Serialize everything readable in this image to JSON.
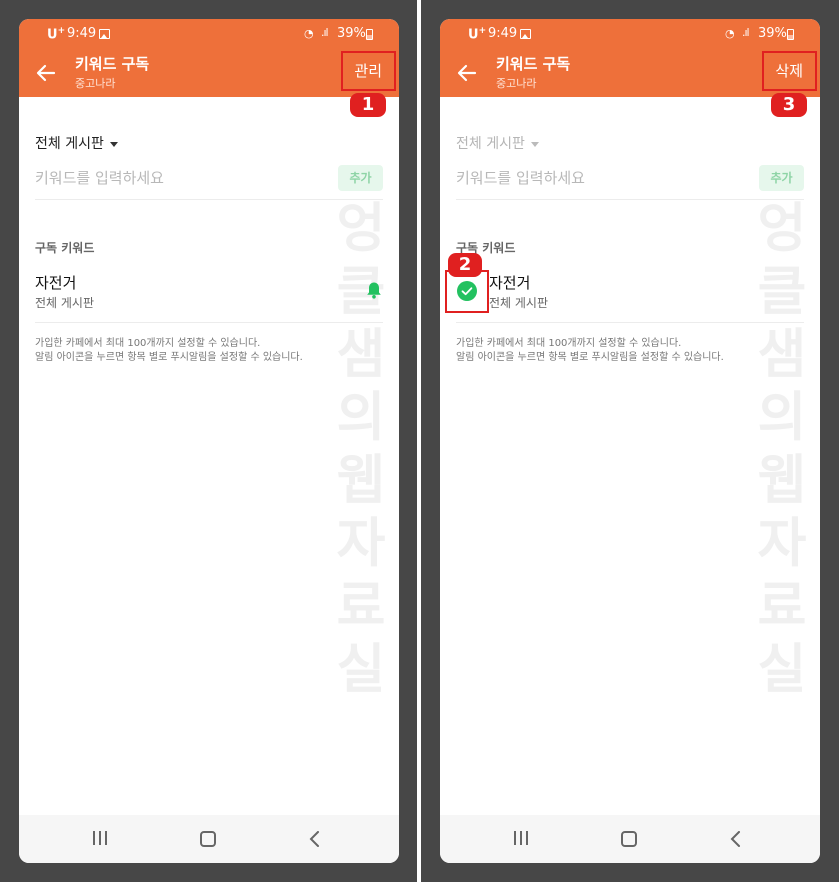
{
  "colors": {
    "accent": "#ee703a",
    "green": "#23c160",
    "highlight": "#e02020"
  },
  "status": {
    "carrier": "U",
    "carrier_mark": "+",
    "time": "9:49",
    "battery": "39%"
  },
  "header": {
    "title": "키워드 구독",
    "subtitle": "중고나라"
  },
  "screens": {
    "left": {
      "action_label": "관리",
      "badge": "1"
    },
    "right": {
      "action_label": "삭제",
      "badge_action": "3",
      "badge_check": "2"
    }
  },
  "filter_label": "전체 게시판",
  "keyword_input": {
    "placeholder": "키워드를 입력하세요"
  },
  "add_button": "추가",
  "section_title": "구독 키워드",
  "keyword_item": {
    "title": "자전거",
    "board": "전체 게시판"
  },
  "notes": [
    "가입한 카페에서 최대 100개까지 설정할 수 있습니다.",
    "알림 아이콘을 누르면 항목 별로 푸시알림을 설정할 수 있습니다."
  ],
  "watermark": "엉클샘의웹자료실",
  "icons": {
    "back": "back-arrow-icon",
    "bell": "bell-icon",
    "check": "check-circle-icon",
    "recents": "recents-icon",
    "home": "home-icon",
    "nav_back": "nav-back-icon"
  }
}
